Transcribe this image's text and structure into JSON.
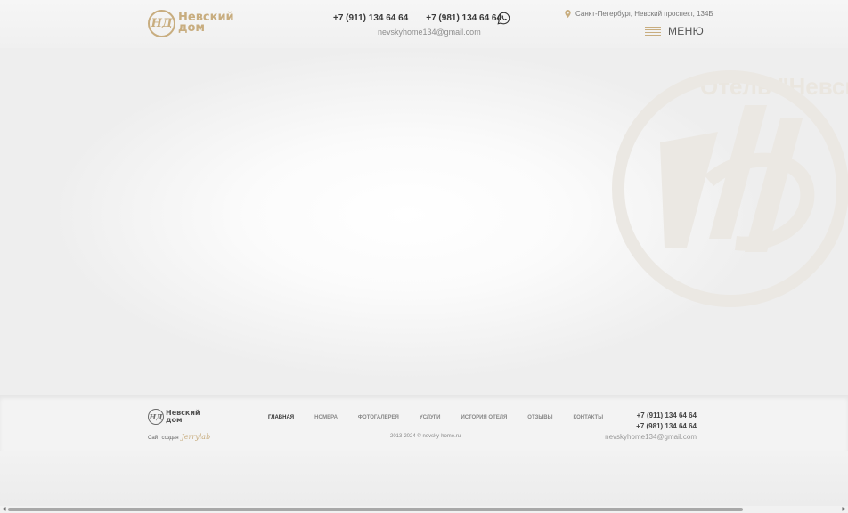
{
  "header": {
    "logo": {
      "mark": "НД",
      "line1": "Невский",
      "line2": "дом"
    },
    "phones": [
      "+7 (911) 134 64 64",
      "+7 (981) 134 64 64"
    ],
    "whatsapp_icon": "whatsapp-icon",
    "email": "nevskyhome134@gmail.com",
    "address": "Санкт-Петербург, Невский проспект, 134Б",
    "menu_label": "МЕНЮ"
  },
  "hero": {
    "title": "Отель \"Невский"
  },
  "footer": {
    "logo": {
      "mark": "НД",
      "line1": "Невский",
      "line2": "дом"
    },
    "creator_label": "Сайт создан",
    "creator_brand": "Jerrylab",
    "nav": [
      {
        "label": "Главная",
        "active": true
      },
      {
        "label": "Номера",
        "active": false
      },
      {
        "label": "Фотогалерея",
        "active": false
      },
      {
        "label": "Услуги",
        "active": false
      },
      {
        "label": "История отеля",
        "active": false
      },
      {
        "label": "Отзывы",
        "active": false
      },
      {
        "label": "Контакты",
        "active": false
      }
    ],
    "copyright": "2013-2024 © nevsky-home.ru",
    "phones": [
      "+7 (911) 134 64 64",
      "+7 (981) 134 64 64"
    ],
    "email": "nevskyhome134@gmail.com"
  },
  "scrollbar": {
    "left_arrow": "◀",
    "right_arrow": "▶"
  },
  "colors": {
    "accent": "#c8ad7f",
    "text": "#3a3a3a"
  }
}
